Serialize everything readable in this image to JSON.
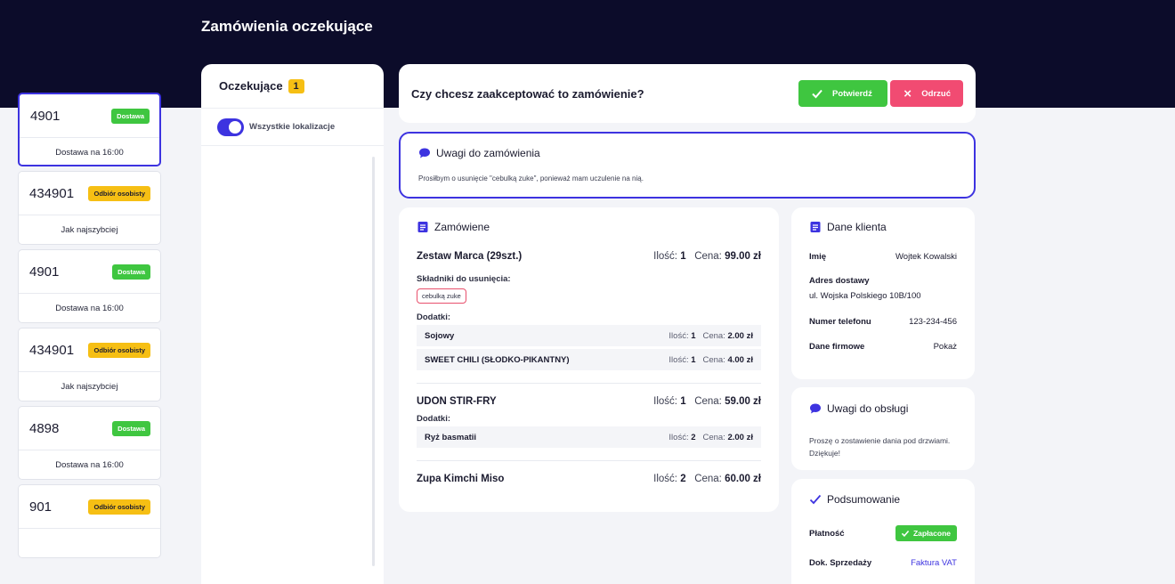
{
  "page_title": "Zamówienia oczekujące",
  "left": {
    "header_label": "Oczekujące",
    "count": "1",
    "toggle_label": "Wszystkie lokalizacje",
    "orders": [
      {
        "number": "4901",
        "badge": "Dostawa",
        "badge_color": "#3fc640",
        "time": "Dostawa na 16:00",
        "selected": true
      },
      {
        "number": "434901",
        "badge": "Odbiór osobisty",
        "badge_color": "#f6bf14",
        "time": "Jak najszybciej"
      },
      {
        "number": "4901",
        "badge": "Dostawa",
        "badge_color": "#3fc640",
        "time": "Dostawa na 16:00"
      },
      {
        "number": "434901",
        "badge": "Odbiór osobisty",
        "badge_color": "#f6bf14",
        "time": "Jak najszybciej"
      },
      {
        "number": "4898",
        "badge": "Dostawa",
        "badge_color": "#3fc640",
        "time": "Dostawa na 16:00"
      },
      {
        "number": "901",
        "badge": "Odbiór osobisty",
        "badge_color": "#f6bf14",
        "time": ""
      }
    ]
  },
  "confirm": {
    "question": "Czy chcesz zaakceptować to zamówienie?",
    "confirm_label": "Potwierdź",
    "reject_label": "Odrzuć"
  },
  "order_notes": {
    "title": "Uwagi do zamówienia",
    "text": "Prosiłbym o usunięcie \"cebulką zuke\", ponieważ mam uczulenie na nią."
  },
  "ordered": {
    "title": "Zamówiene",
    "qty_label": "Ilość:",
    "price_label": "Cena:",
    "removals_label": "Składniki do usunięcia:",
    "addons_label": "Dodatki:",
    "items": [
      {
        "name": "Zestaw Marca (29szt.)",
        "qty": "1",
        "price": "99.00 zł",
        "removals": [
          "cebulką zuke"
        ],
        "addons": [
          {
            "name": "Sojowy",
            "qty": "1",
            "price": "2.00 zł"
          },
          {
            "name": "SWEET CHILI (SŁODKO-PIKANTNY)",
            "qty": "1",
            "price": "4.00 zł"
          }
        ]
      },
      {
        "name": "UDON STIR-FRY",
        "qty": "1",
        "price": "59.00 zł",
        "addons": [
          {
            "name": "Ryż basmatii",
            "qty": "2",
            "price": "2.00 zł"
          }
        ]
      },
      {
        "name": "Zupa Kimchi Miso",
        "qty": "2",
        "price": "60.00 zł"
      }
    ]
  },
  "client": {
    "title": "Dane klienta",
    "name_label": "Imię",
    "name": "Wojtek Kowalski",
    "address_label": "Adres dostawy",
    "address": "ul. Wojska Polskiego 10B/100",
    "phone_label": "Numer telefonu",
    "phone": "123-234-456",
    "company_label": "Dane firmowe",
    "company_action": "Pokaż"
  },
  "staff_notes": {
    "title": "Uwagi do obsługi",
    "text": "Proszę o zostawienie dania pod drzwiami. Dziękuje!"
  },
  "summary": {
    "title": "Podsumowanie",
    "payment_label": "Płatność",
    "payment_status": "Zapłacone",
    "sale_doc_label": "Dok. Sprzedaży",
    "sale_doc": "Faktura VAT"
  },
  "colors": {
    "accent": "#3d33e0",
    "success": "#3fc640",
    "warning": "#f6bf14",
    "danger": "#f14b72",
    "header_bg": "#0c0c2a"
  }
}
